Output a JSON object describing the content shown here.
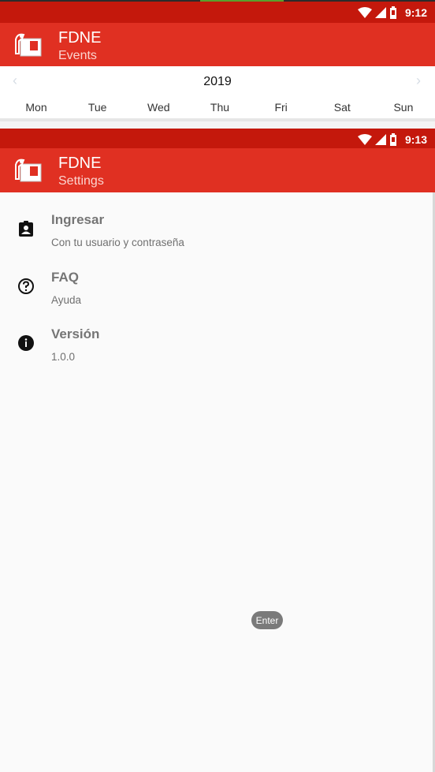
{
  "top_screen": {
    "status": {
      "time": "9:12"
    },
    "appbar": {
      "title": "FDNE",
      "subtitle": "Events"
    },
    "calendar": {
      "year": "2019",
      "days": [
        "Mon",
        "Tue",
        "Wed",
        "Thu",
        "Fri",
        "Sat",
        "Sun"
      ]
    }
  },
  "bottom_screen": {
    "status": {
      "time": "9:13"
    },
    "appbar": {
      "title": "FDNE",
      "subtitle": "Settings"
    },
    "items": [
      {
        "label": "Ingresar",
        "desc": "Con tu usuario y contraseña",
        "icon": "assignment-ind-icon"
      },
      {
        "label": "FAQ",
        "desc": "Ayuda",
        "icon": "help-outline-icon"
      },
      {
        "label": "Versión",
        "desc": "1.0.0",
        "icon": "info-icon"
      }
    ]
  },
  "tooltip": {
    "label": "Enter"
  },
  "colors": {
    "status_bar": "#c4180c",
    "app_bar": "#e03022",
    "background": "#fafafa"
  }
}
